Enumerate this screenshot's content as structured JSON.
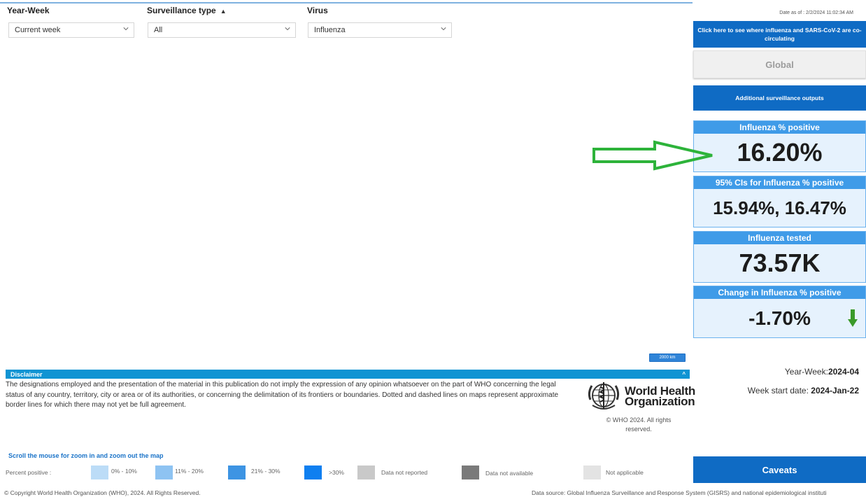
{
  "filters": {
    "year_week": {
      "label": "Year-Week",
      "value": "Current week"
    },
    "surveillance_type": {
      "label": "Surveillance type",
      "sort_icon": "sort-indicator",
      "value": "All"
    },
    "virus": {
      "label": "Virus",
      "value": "Influenza"
    }
  },
  "date_as_of": "Date as of : 2/2/2024 11:02:34 AM",
  "buttons": {
    "cocirculating": "Click here to see where influenza and SARS-CoV-2 are co-circulating",
    "global": "Global",
    "additional": "Additional surveillance outputs",
    "caveats": "Caveats"
  },
  "cards": {
    "percent_positive": {
      "title": "Influenza % positive",
      "value": "16.20%"
    },
    "ci": {
      "title": "95% CIs for Influenza % positive",
      "value": "15.94%, 16.47%"
    },
    "tested": {
      "title": "Influenza tested",
      "value": "73.57K"
    },
    "change": {
      "title": "Change in Influenza % positive",
      "value": "-1.70%",
      "trend_icon": "down-arrow-icon"
    }
  },
  "annotation": {
    "arrow_icon": "right-arrow-outline-icon",
    "color": "#2db33a"
  },
  "map": {
    "scale_bar": "2000 km"
  },
  "disclaimer": {
    "title": "Disclaimer",
    "collapse_icon": "caret-up-icon",
    "text": "The designations employed and the presentation of the material in this publication do not imply the expression of any opinion whatsoever on the part of WHO concerning the legal status of any country, territory, city or area or of its authorities, or concerning the delimitation of its frontiers or boundaries. Dotted and dashed lines on maps represent approximate border lines for which there may not yet be full agreement."
  },
  "who": {
    "logo_icon": "who-emblem-icon",
    "name_line1": "World Health",
    "name_line2": "Organization",
    "copyright_line1": "© WHO 2024. All rights",
    "copyright_line2": "reserved."
  },
  "week_info": {
    "year_week_label": "Year-Week:",
    "year_week_value": "2024-04",
    "start_label": "Week start date:",
    "start_value": "2024-Jan-22"
  },
  "zoom_hint": "Scroll the mouse for zoom in and zoom out the map",
  "legend": {
    "title": "Percent positive :",
    "items": [
      {
        "label": "0% - 10%",
        "color": "#bcdcf7"
      },
      {
        "label": "11% - 20%",
        "color": "#8ec3f2"
      },
      {
        "label": "21% - 30%",
        "color": "#3d94e3"
      },
      {
        "label": ">30%",
        "color": "#0f7ff0"
      },
      {
        "label": "Data not reported",
        "color": "#c9c9c9"
      },
      {
        "label": "Data not available",
        "color": "#7a7a7a"
      },
      {
        "label": "Not applicable",
        "color": "#e3e3e3"
      }
    ]
  },
  "footer": {
    "copyright": "© Copyright World Health Organization (WHO), 2024. All Rights Reserved.",
    "source": "Data source: Global Influenza Surveillance and Response System (GISRS) and national epidemiological instituti"
  },
  "colors": {
    "accent": "#0f6bc4",
    "card_header": "#3f9be8",
    "card_bg": "#e6f2fd",
    "disclaimer_bar": "#1094d3",
    "down_arrow": "#3a9a2a"
  }
}
